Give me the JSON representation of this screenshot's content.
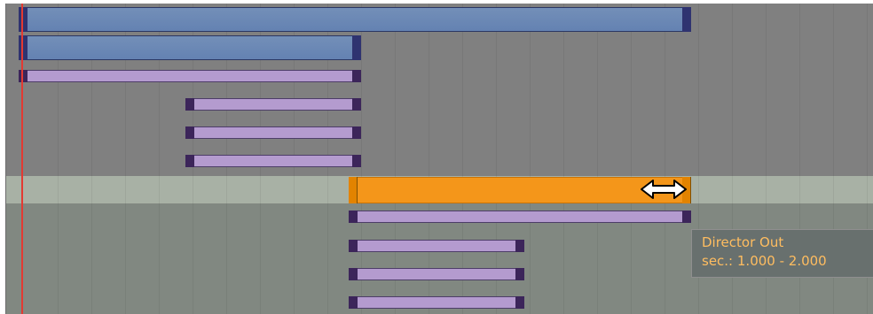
{
  "tooltip": {
    "title": "Director Out",
    "range": "sec.: 1.000 - 2.000"
  },
  "colors": {
    "playhead": "#e33a32",
    "highlight": "#f4961a",
    "blue_track": "#6482b2",
    "lavender_track": "#b49bcf"
  },
  "icons": {
    "resize_cursor": "double-arrow-horizontal"
  }
}
